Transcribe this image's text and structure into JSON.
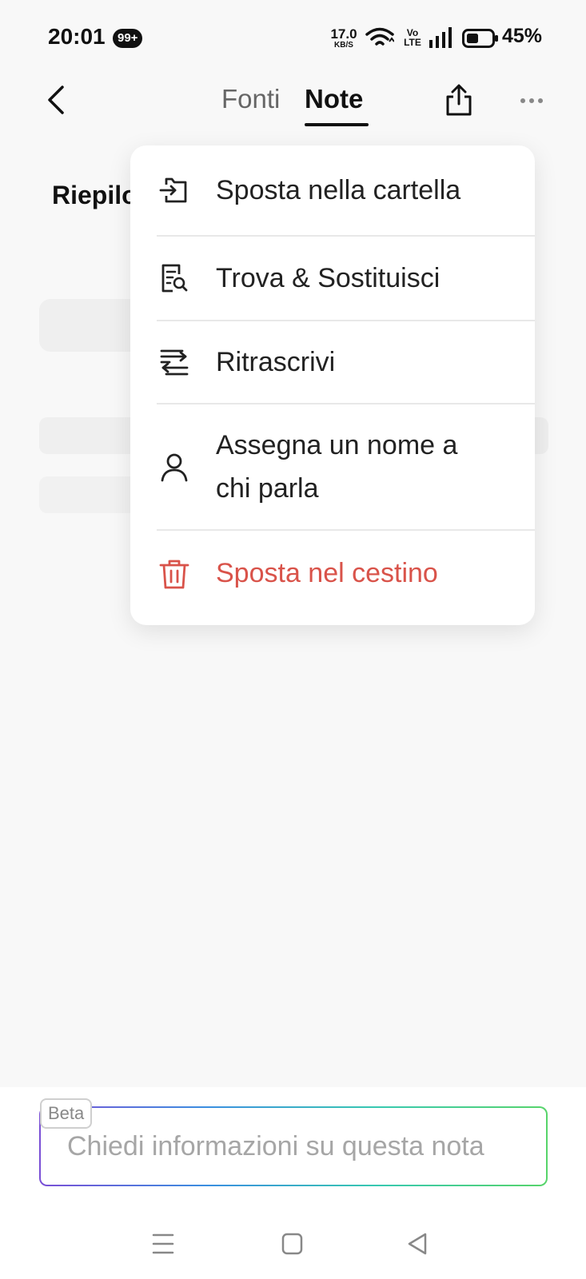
{
  "status_bar": {
    "time": "20:01",
    "notification_badge": "99+",
    "net_speed_value": "17.0",
    "net_speed_unit": "KB/S",
    "volte_top": "Vo",
    "volte_bottom": "LTE",
    "battery_percent": "45%",
    "battery_level": 0.45
  },
  "header": {
    "tabs": [
      {
        "label": "Fonti",
        "active": false
      },
      {
        "label": "Note",
        "active": true
      }
    ]
  },
  "content": {
    "section_title": "Riepilo"
  },
  "menu": {
    "items": [
      {
        "label": "Sposta nella cartella",
        "icon": "move-to-folder-icon"
      },
      {
        "label": "Trova & Sostituisci",
        "icon": "find-replace-icon"
      },
      {
        "label": "Ritrascrivi",
        "icon": "retranscribe-icon"
      },
      {
        "label": "Assegna un nome a chi parla",
        "icon": "person-icon"
      },
      {
        "label": "Sposta nel cestino",
        "icon": "trash-icon",
        "danger": true
      }
    ]
  },
  "ask": {
    "badge": "Beta",
    "placeholder": "Chiedi informazioni su questa nota"
  },
  "colors": {
    "danger": "#d9534a",
    "gradient": [
      "#7a4fd6",
      "#3a8fe0",
      "#38c9b0",
      "#57d46a"
    ]
  }
}
